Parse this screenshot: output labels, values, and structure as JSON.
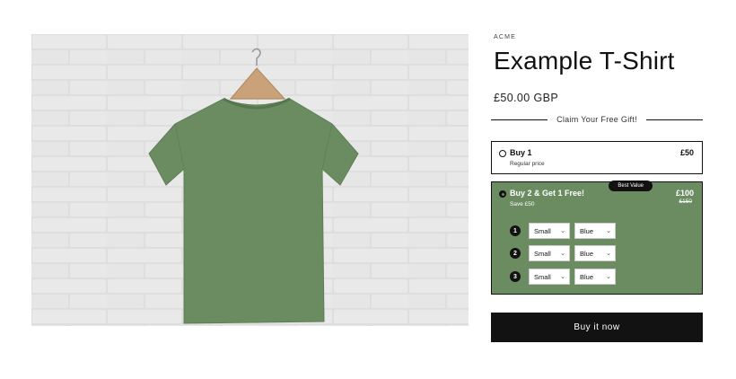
{
  "product": {
    "vendor": "ACME",
    "title": "Example T-Shirt",
    "price": "£50.00 GBP",
    "image_icon": "tshirt-photo",
    "shirt_color": "#6b8c61"
  },
  "gift": {
    "label": "Claim Your Free Gift!"
  },
  "offers": [
    {
      "title": "Buy 1",
      "subtitle": "Regular price",
      "price": "£50",
      "selected": false
    },
    {
      "title": "Buy 2 & Get 1 Free!",
      "subtitle": "Save £50",
      "price": "£100",
      "compare_price": "£150",
      "badge": "Best Value",
      "selected": true,
      "background": "#6b8c61",
      "items": [
        {
          "number": "1",
          "size": "Small",
          "color": "Blue"
        },
        {
          "number": "2",
          "size": "Small",
          "color": "Blue"
        },
        {
          "number": "3",
          "size": "Small",
          "color": "Blue"
        }
      ]
    }
  ],
  "buy_button": {
    "label": "Buy it now"
  }
}
